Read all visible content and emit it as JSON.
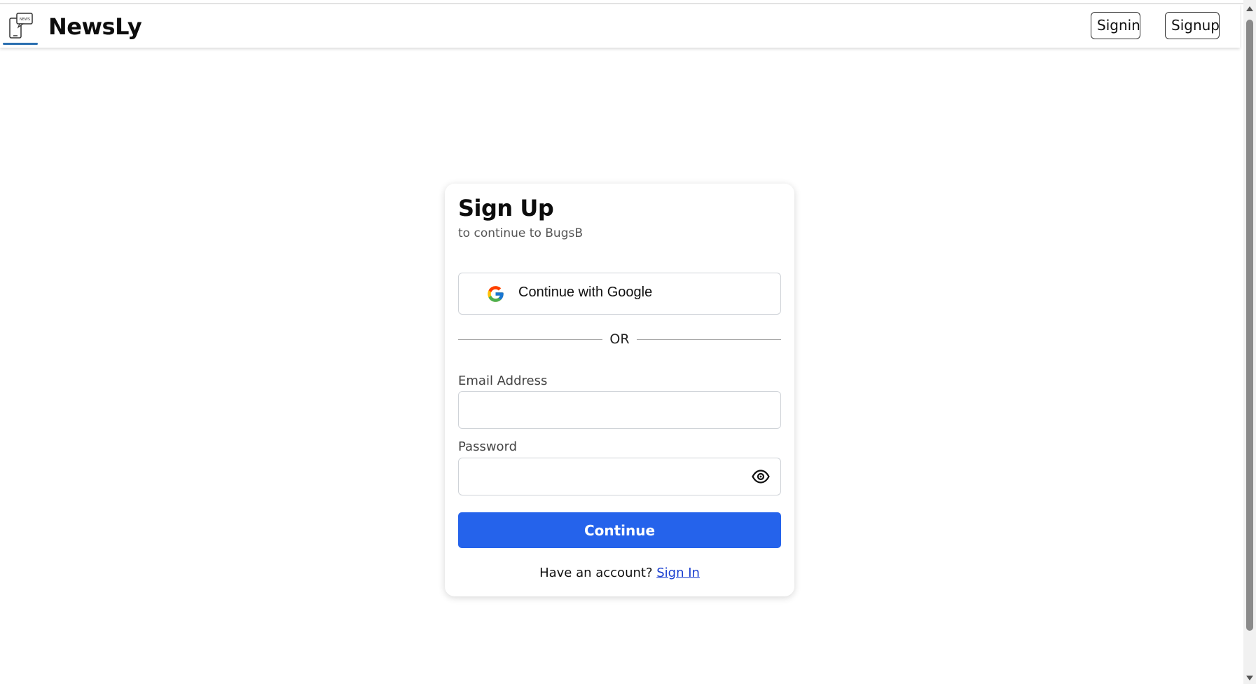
{
  "navbar": {
    "brand": "NewsLy",
    "signin_label": "Signin",
    "signup_label": "Signup",
    "logo_icon": "news-phone-icon"
  },
  "signup_card": {
    "title": "Sign Up",
    "subtitle": "to continue to BugsB",
    "google_button_label": "Continue with Google",
    "divider_text": "OR",
    "email_label": "Email Address",
    "email_value": "",
    "password_label": "Password",
    "password_value": "",
    "continue_label": "Continue",
    "account_prompt": "Have an account?",
    "signin_link": "Sign In"
  },
  "colors": {
    "primary": "#2563eb",
    "link": "#1a3fd0",
    "logo_accent": "#2a6fb0"
  }
}
